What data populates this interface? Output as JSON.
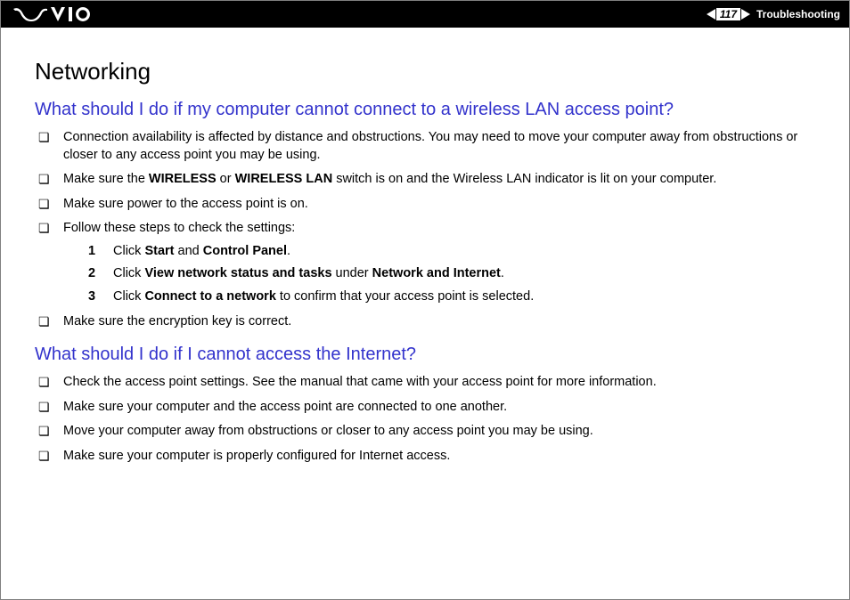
{
  "header": {
    "page_number": "117",
    "section": "Troubleshooting"
  },
  "title": "Networking",
  "q1": {
    "heading": "What should I do if my computer cannot connect to a wireless LAN access point?",
    "b1": "Connection availability is affected by distance and obstructions. You may need to move your computer away from obstructions or closer to any access point you may be using.",
    "b2_pre": "Make sure the ",
    "b2_b1": "WIRELESS",
    "b2_mid1": " or ",
    "b2_b2": "WIRELESS LAN",
    "b2_post": " switch is on and the Wireless LAN indicator is lit on your computer.",
    "b3": "Make sure power to the access point is on.",
    "b4": "Follow these steps to check the settings:",
    "s1_num": "1",
    "s1_pre": "Click ",
    "s1_b1": "Start",
    "s1_mid": " and ",
    "s1_b2": "Control Panel",
    "s1_post": ".",
    "s2_num": "2",
    "s2_pre": "Click ",
    "s2_b1": "View network status and tasks",
    "s2_mid": " under ",
    "s2_b2": "Network and Internet",
    "s2_post": ".",
    "s3_num": "3",
    "s3_pre": "Click ",
    "s3_b1": "Connect to a network",
    "s3_post": " to confirm that your access point is selected.",
    "b5": "Make sure the encryption key is correct."
  },
  "q2": {
    "heading": "What should I do if I cannot access the Internet?",
    "b1": "Check the access point settings. See the manual that came with your access point for more information.",
    "b2": "Make sure your computer and the access point are connected to one another.",
    "b3": "Move your computer away from obstructions or closer to any access point you may be using.",
    "b4": "Make sure your computer is properly configured for Internet access."
  }
}
